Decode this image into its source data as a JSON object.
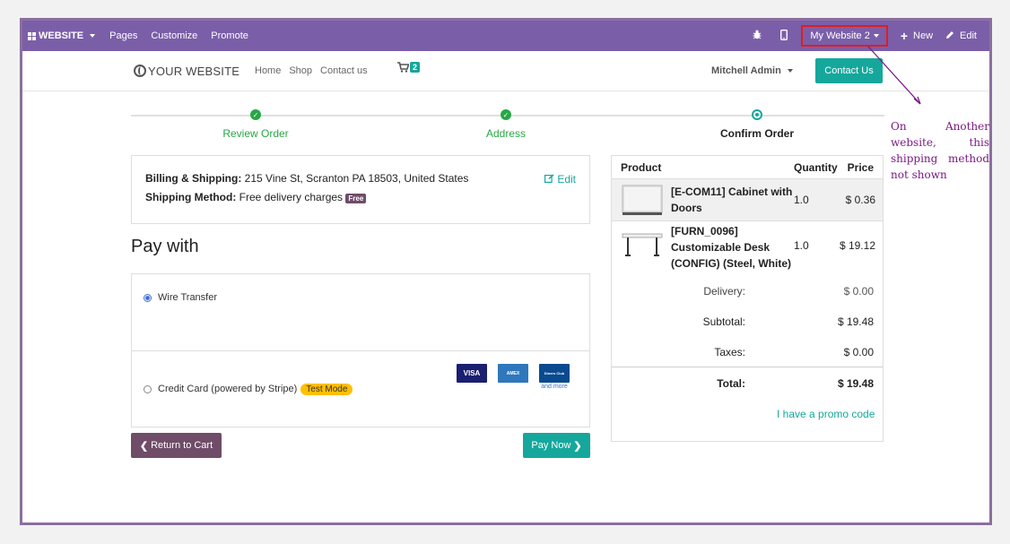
{
  "topbar": {
    "brand": "WEBSITE",
    "menus": [
      "Pages",
      "Customize",
      "Promote"
    ],
    "website_selector": "My Website 2",
    "new_label": "New",
    "edit_label": "Edit"
  },
  "navbar": {
    "logo": "YOUR WEBSITE",
    "links": [
      "Home",
      "Shop",
      "Contact us"
    ],
    "cart_count": "2",
    "user": "Mitchell Admin",
    "contact_button": "Contact Us"
  },
  "steps": [
    {
      "label": "Review Order",
      "state": "done"
    },
    {
      "label": "Address",
      "state": "done"
    },
    {
      "label": "Confirm Order",
      "state": "current"
    }
  ],
  "billing": {
    "billing_label": "Billing & Shipping:",
    "billing_value": "215 Vine St, Scranton PA 18503, United States",
    "shipping_label": "Shipping Method:",
    "shipping_value": "Free delivery charges",
    "free_badge": "Free",
    "edit_label": "Edit"
  },
  "pay_with_title": "Pay with",
  "payment_methods": [
    {
      "label": "Wire Transfer",
      "selected": true
    },
    {
      "label": "Credit Card (powered by Stripe)",
      "selected": false,
      "badge": "Test Mode"
    }
  ],
  "card_logos": [
    "VISA",
    "AMEX",
    "Diners Club"
  ],
  "card_more": "and more",
  "buttons": {
    "back": "Return to Cart",
    "pay": "Pay Now"
  },
  "summary": {
    "headers": {
      "product": "Product",
      "quantity": "Quantity",
      "price": "Price"
    },
    "items": [
      {
        "name": "[E-COM11] Cabinet with Doors",
        "qty": "1.0",
        "price": "$ 0.36"
      },
      {
        "name": "[FURN_0096] Customizable Desk (CONFIG) (Steel, White)",
        "qty": "1.0",
        "price": "$ 19.12"
      }
    ],
    "delivery_label": "Delivery:",
    "delivery_value": "$ 0.00",
    "subtotal_label": "Subtotal:",
    "subtotal_value": "$ 19.48",
    "taxes_label": "Taxes:",
    "taxes_value": "$ 0.00",
    "total_label": "Total:",
    "total_value": "$ 19.48",
    "promo": "I have a promo code"
  },
  "annotation": "On Another website, this shipping method not shown",
  "colors": {
    "topbar": "#7a5fa8",
    "accent": "#16a79c",
    "secondary": "#6f4c68",
    "success": "#28a745",
    "highlight": "#e01b24",
    "annotation": "#7a1a84"
  }
}
